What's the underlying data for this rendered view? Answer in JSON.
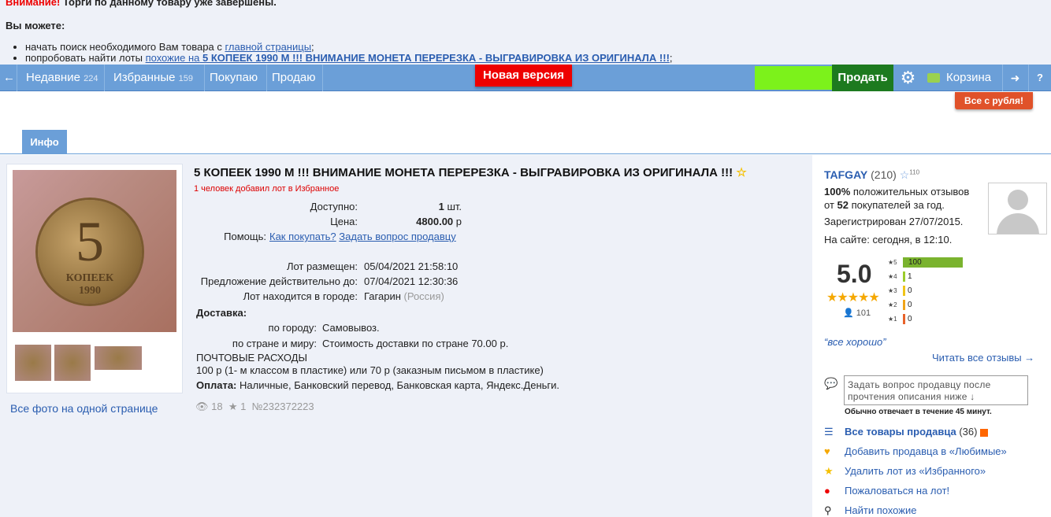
{
  "notice": {
    "warning_word": "Внимание!",
    "warning_text": " Торги по данному товару уже завершены.",
    "can_title": "Вы можете:",
    "item1_text": "начать поиск необходимого Вам товара с ",
    "item1_link": "главной страницы",
    "item1_end": ";",
    "item2_text": "попробовать найти лоты ",
    "item2_link": "похожие на",
    "item2_bold": " 5 КОПЕЕК 1990 М !!! ВНИМАНИЕ МОНЕТА ПЕРЕРЕЗКА - ВЫГРАВИРОВКА ИЗ ОРИГИНАЛА !!!",
    "item2_end": ";"
  },
  "toolbar": {
    "back": "←",
    "recent_label": "Недавние",
    "recent_count": "224",
    "fav_label": "Избранные",
    "fav_count": "159",
    "buy_label": "Покупаю",
    "sell_label_left": "Продаю",
    "new_version": "Новая версия",
    "sell_button": "Продать",
    "gear": "⚙",
    "cart_label": "Корзина",
    "exit": "➜",
    "help": "?",
    "ruble_badge": "Все с рубля!"
  },
  "tab": {
    "info": "Инфо"
  },
  "lot": {
    "title": "5 КОПЕЕК 1990 М !!! ВНИМАНИЕ МОНЕТА ПЕРЕРЕЗКА - ВЫГРАВИРОВКА ИЗ ОРИГИНАЛА !!!",
    "star": "☆",
    "favorites_note": "1 человек добавил лот в Избранное",
    "coin_number": "5",
    "coin_text": "КОПЕЕК",
    "coin_year": "1990",
    "available_label": "Доступно:",
    "available_value": "1",
    "available_unit": " шт.",
    "price_label": "Цена:",
    "price_value": "4800.00",
    "price_unit": " р",
    "help_label": "Помощь:",
    "help_link1": "Как покупать?",
    "help_link2": "Задать вопрос продавцу",
    "placed_label": "Лот размещен:",
    "placed_value": "05/04/2021 21:58:10",
    "valid_label": "Предложение действительно до:",
    "valid_value": "07/04/2021 12:30:36",
    "city_label": "Лот находится в городе:",
    "city_value": "Гагарин",
    "city_country": " (Россия)",
    "delivery_label": "Доставка:",
    "city_delivery_label": "по городу:",
    "city_delivery_value": "Самовывоз.",
    "country_delivery_label": "по стране и миру:",
    "country_delivery_value": "Стоимость доставки по стране 70.00 р.",
    "postal_title": "ПОЧТОВЫЕ РАСХОДЫ",
    "postal_text": "100 р (1- м классом в пластике) или 70 р (заказным письмом в пластике)",
    "payment_label": "Оплата:",
    "payment_value": " Наличные, Банковский перевод, Банковская карта, Яндекс.Деньги.",
    "views": "18",
    "stars_count": "1",
    "lot_number": "№232372223",
    "all_photos": "Все фото на одной странице"
  },
  "seller": {
    "name": "TAFGAY",
    "rating": "(210)",
    "star_count": "110",
    "positive_pct": "100%",
    "positive_text": " положительных отзывов",
    "from_text": "от ",
    "buyers_count": "52",
    "buyers_text": " покупателей за год.",
    "registered": "Зарегистрирован 27/07/2015.",
    "online": "На сайте: сегодня, в 12:10.",
    "score": "5.0",
    "score_stars": "★★★★★",
    "reviews_count": "101",
    "rating_bars": [
      {
        "stars": "★5",
        "value": "100",
        "fraction": 1.0,
        "color": "#7ab32e"
      },
      {
        "stars": "★4",
        "value": "1",
        "fraction": 0.01,
        "color": "#9ccc2c"
      },
      {
        "stars": "★3",
        "value": "0",
        "fraction": 0,
        "color": "#f0c419"
      },
      {
        "stars": "★2",
        "value": "0",
        "fraction": 0,
        "color": "#f0a419"
      },
      {
        "stars": "★1",
        "value": "0",
        "fraction": 0,
        "color": "#e8632a"
      }
    ],
    "quote": "“все хорошо”",
    "read_all": "Читать все отзывы →",
    "ask_placeholder": "Задать вопрос продавцу после прочтения описания ниже ↓",
    "response_time": "Обычно отвечает в течение 45 минут.",
    "all_items_label": "Все товары продавца",
    "all_items_count": " (36)",
    "add_fav": "Добавить продавца в «Любимые»",
    "remove_fav": "Удалить лот из «Избранного»",
    "complain": "Пожаловаться на лот!",
    "find_similar": "Найти похожие"
  }
}
